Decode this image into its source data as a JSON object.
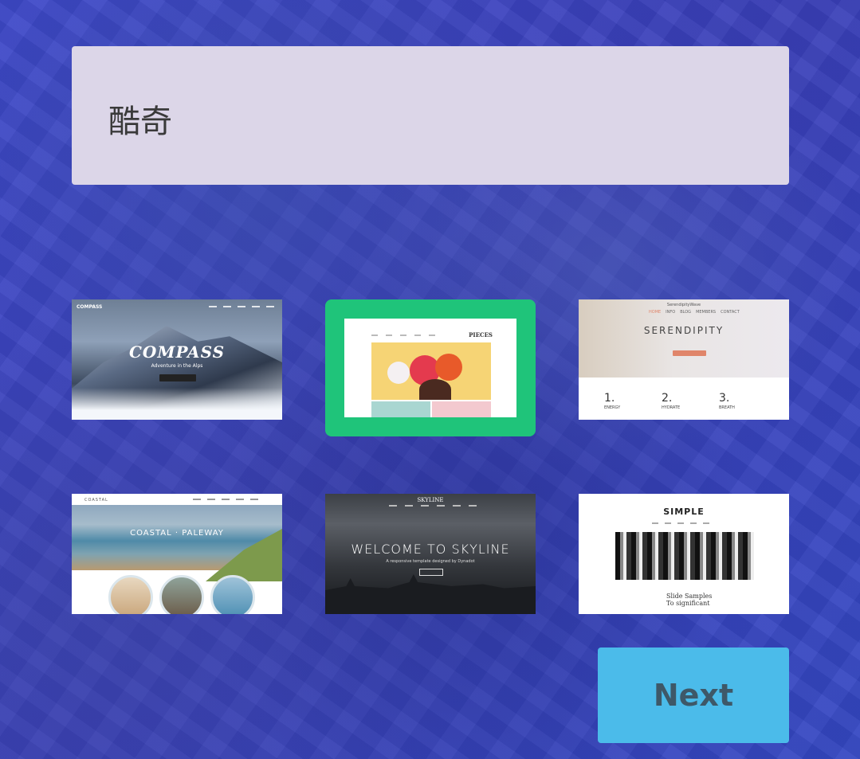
{
  "site_name": "酷奇",
  "templates": [
    {
      "id": "compass",
      "title": "COMPASS",
      "logo": "COMPASS",
      "subtitle": "Adventure in the Alps",
      "selected": false
    },
    {
      "id": "pieces",
      "logo": "PIECES",
      "selected": true
    },
    {
      "id": "serendipity",
      "brand": "SerendipityWave",
      "nav": [
        "HOME",
        "INFO",
        "BLOG",
        "MEMBERS",
        "CONTACT"
      ],
      "title": "SERENDIPITY",
      "features": [
        {
          "num": "1.",
          "label": "ENERGY"
        },
        {
          "num": "2.",
          "label": "HYDRATE"
        },
        {
          "num": "3.",
          "label": "BREATH"
        }
      ],
      "selected": false
    },
    {
      "id": "coastal",
      "logo": "COASTAL",
      "title": "COASTAL · PALEWAY",
      "selected": false
    },
    {
      "id": "skyline",
      "logo": "SKYLINE",
      "title": "WELCOME TO SKYLINE",
      "subtitle": "A responsive template designed by Dynadot",
      "selected": false
    },
    {
      "id": "simple",
      "title": "SIMPLE",
      "text_line1": "Slide Samples",
      "text_line2": "To significant",
      "selected": false
    }
  ],
  "next_label": "Next",
  "colors": {
    "selected_border": "#1fc47a",
    "next_button": "#4bbbea",
    "name_box": "#dcd6e8"
  }
}
